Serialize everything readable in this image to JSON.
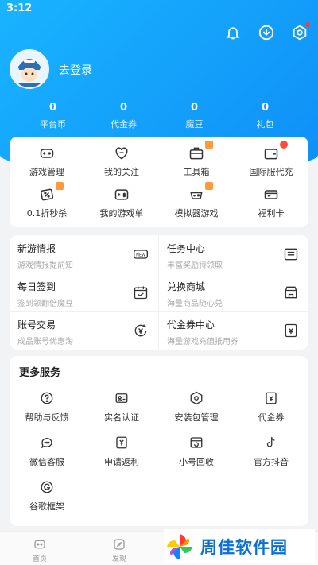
{
  "status_bar": {
    "time": "3:12"
  },
  "header": {
    "icons": [
      "bell-icon",
      "download-icon",
      "settings-icon"
    ],
    "login_text": "去登录"
  },
  "stats": [
    {
      "value": "0",
      "label": "平台币"
    },
    {
      "value": "0",
      "label": "代金券"
    },
    {
      "value": "0",
      "label": "魔豆"
    },
    {
      "value": "0",
      "label": "礼包"
    }
  ],
  "quick_grid": [
    {
      "label": "游戏管理",
      "icon": "gamepad-icon"
    },
    {
      "label": "我的关注",
      "icon": "heart-icon"
    },
    {
      "label": "工具箱",
      "icon": "toolbox-icon"
    },
    {
      "label": "国际服代充",
      "icon": "wallet-icon"
    },
    {
      "label": "0.1折秒杀",
      "icon": "discount-tag-icon"
    },
    {
      "label": "我的游戏单",
      "icon": "game-list-icon"
    },
    {
      "label": "模拟器游戏",
      "icon": "emulator-icon"
    },
    {
      "label": "福利卡",
      "icon": "card-icon"
    }
  ],
  "info_items": [
    {
      "title": "新游情报",
      "sub": "游戏情报提前知"
    },
    {
      "title": "任务中心",
      "sub": "丰富奖励待领取"
    },
    {
      "title": "每日签到",
      "sub": "签到领翻倍魔豆"
    },
    {
      "title": "兑换商城",
      "sub": "海量商品随心兑"
    },
    {
      "title": "账号交易",
      "sub": "成品账号优惠淘"
    },
    {
      "title": "代金券中心",
      "sub": "海量游戏充值抵用券"
    }
  ],
  "more_services": {
    "title": "更多服务",
    "items": [
      {
        "label": "帮助与反馈"
      },
      {
        "label": "实名认证"
      },
      {
        "label": "安装包管理"
      },
      {
        "label": "代金券"
      },
      {
        "label": "微信客服"
      },
      {
        "label": "申请返利"
      },
      {
        "label": "小号回收"
      },
      {
        "label": "官方抖音"
      },
      {
        "label": "谷歌框架"
      }
    ]
  },
  "bottom_nav": [
    {
      "label": "首页"
    },
    {
      "label": "发现"
    }
  ],
  "watermark": {
    "text": "周佳软件园"
  },
  "colors": {
    "brand": "#0f8ff7",
    "accent_badge": "#ff9a3c",
    "red_badge": "#ff4d3a"
  }
}
